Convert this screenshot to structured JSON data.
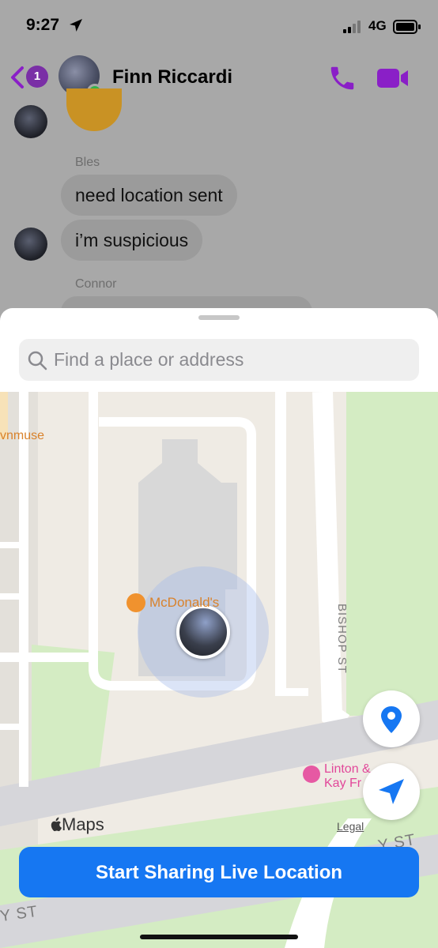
{
  "status_bar": {
    "time": "9:27",
    "network": "4G"
  },
  "header": {
    "unread_count": "1",
    "contact_name": "Finn Riccardi"
  },
  "messages": {
    "sender_1": "Bles",
    "bubble_1": "need location sent",
    "bubble_2": "i’m suspicious",
    "sender_2": "Connor"
  },
  "sheet": {
    "search_placeholder": "Find a place or address",
    "cta_label": "Start Sharing Live Location"
  },
  "map": {
    "poi_partial": "vnmuse",
    "poi_mcdonalds": "McDonald's",
    "street_bishop": "BISHOP ST",
    "poi_linton_line1": "Linton &",
    "poi_linton_line2": "Kay Fr",
    "street_y_right": "Y ST",
    "street_y_left": "Y ST",
    "maps_brand": "Maps",
    "legal": "Legal"
  },
  "colors": {
    "messenger_purple": "#8a1fc7",
    "cta_blue": "#1677f2",
    "map_land": "#efebe4",
    "map_park": "#d4ecc3",
    "map_road": "#ffffff",
    "poi_orange": "#d9822b",
    "poi_pink": "#e2489a"
  },
  "icons": {
    "location": "location-arrow-icon",
    "signal": "signal-bars-icon",
    "battery": "battery-icon",
    "back": "chevron-left-icon",
    "call": "phone-icon",
    "video": "video-camera-icon",
    "search": "search-icon",
    "pin": "map-pin-icon",
    "navigate": "navigation-arrow-icon",
    "apple": "apple-logo-icon"
  }
}
